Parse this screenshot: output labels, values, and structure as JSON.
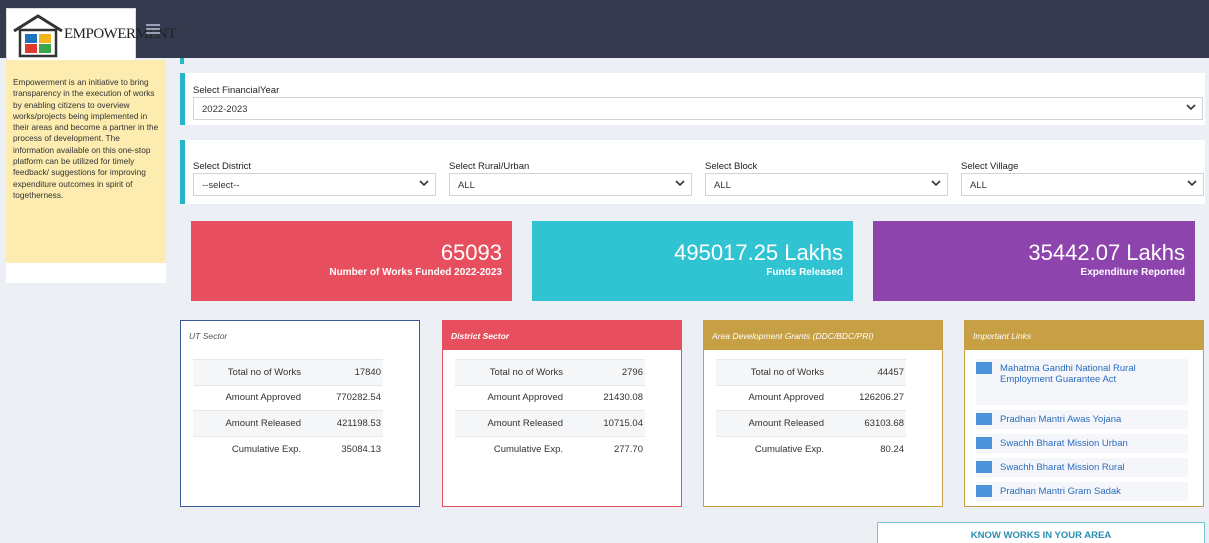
{
  "header": {
    "brand": "EMPOWERMENT",
    "menu_icon": "hamburger-icon",
    "logo_icon": "house-logo-icon"
  },
  "sidebar": {
    "about": "Empowerment is an initiative to bring transparency in the execution of works by enabling citizens to overview works/projects being implemented in their areas and become a partner in the process of development. The information available on this one-stop platform can be utilized for timely feedback/ suggestions for improving expenditure outcomes in spirit of togetherness."
  },
  "filters": {
    "financial_year": {
      "label": "Select FinancialYear",
      "value": "2022-2023"
    },
    "district": {
      "label": "Select District",
      "value": "--select--"
    },
    "rural_urban": {
      "label": "Select Rural/Urban",
      "value": "ALL"
    },
    "block": {
      "label": "Select Block",
      "value": "ALL"
    },
    "village": {
      "label": "Select Village",
      "value": "ALL"
    }
  },
  "stats": [
    {
      "value": "65093",
      "caption": "Number of Works Funded 2022-2023",
      "color": "#e84f5e"
    },
    {
      "value": "495017.25 Lakhs",
      "caption": "Funds Released",
      "color": "#30c3d2"
    },
    {
      "value": "35442.07 Lakhs",
      "caption": "Expenditure Reported",
      "color": "#8e44ad"
    }
  ],
  "panels": [
    {
      "title": "UT Sector",
      "rows": [
        [
          "Total no of Works",
          "17840"
        ],
        [
          "Amount Approved",
          "770282.54"
        ],
        [
          "Amount Released",
          "421198.53"
        ],
        [
          "Cumulative Exp.",
          "35084.13"
        ]
      ]
    },
    {
      "title": "District Sector",
      "rows": [
        [
          "Total no of Works",
          "2796"
        ],
        [
          "Amount Approved",
          "21430.08"
        ],
        [
          "Amount Released",
          "10715.04"
        ],
        [
          "Cumulative Exp.",
          "277.70"
        ]
      ]
    },
    {
      "title": "Area Development Grants (DDC/BDC/PRI)",
      "rows": [
        [
          "Total no of Works",
          "44457"
        ],
        [
          "Amount Approved",
          "126206.27"
        ],
        [
          "Amount Released",
          "63103.68"
        ],
        [
          "Cumulative Exp.",
          "80.24"
        ]
      ]
    }
  ],
  "important_links": {
    "title": "Important Links",
    "items": [
      "Mahatma Gandhi National Rural Employment Guarantee Act",
      "Pradhan Mantri Awas Yojana",
      "Swachh Bharat Mission Urban",
      "Swachh Bharat Mission Rural",
      "Pradhan Mantri Gram Sadak"
    ]
  },
  "cta": {
    "label": "KNOW WORKS IN YOUR AREA"
  }
}
